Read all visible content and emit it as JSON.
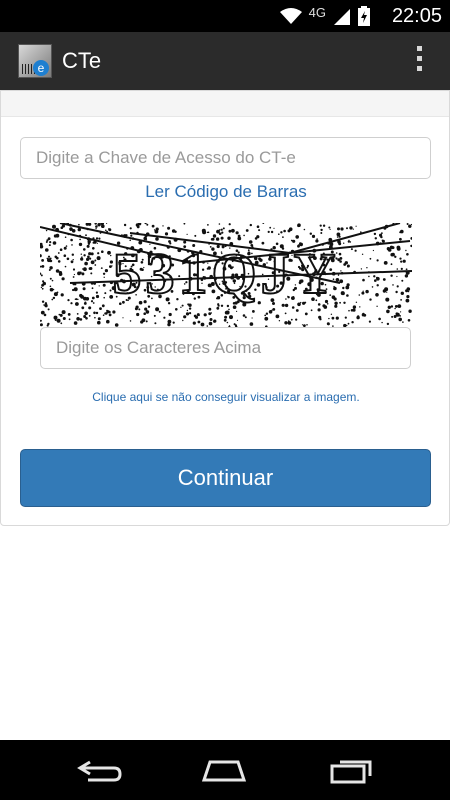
{
  "status_bar": {
    "time": "22:05",
    "network": "4G"
  },
  "app": {
    "title": "CTe",
    "icon_letter": "e"
  },
  "form": {
    "access_key_placeholder": "Digite a Chave de Acesso do CT-e",
    "barcode_link": "Ler Código de Barras",
    "captcha_text": "531QJY",
    "captcha_placeholder": "Digite os Caracteres Acima",
    "captcha_hint": "Clique aqui se não conseguir visualizar a imagem.",
    "continue_label": "Continuar"
  },
  "colors": {
    "accent": "#337ab7",
    "link": "#2a6db0",
    "action_bar": "#2b2b2b"
  }
}
